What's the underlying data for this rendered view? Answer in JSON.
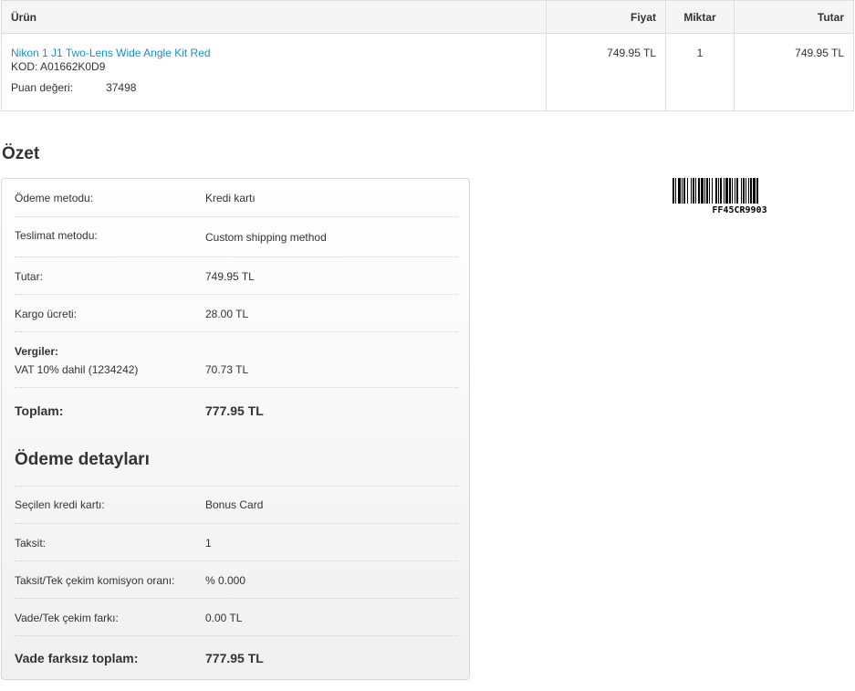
{
  "table": {
    "headers": {
      "product": "Ürün",
      "price": "Fiyat",
      "quantity": "Miktar",
      "total": "Tutar"
    },
    "rows": [
      {
        "name": "Nikon 1 J1 Two-Lens Wide Angle Kit Red",
        "code": "KOD:  A01662K0D9",
        "points_label": "Puan değeri:",
        "points_value": "37498",
        "price": "749.95 TL",
        "quantity": "1",
        "total": "749.95 TL"
      }
    ]
  },
  "summary": {
    "title": "Özet",
    "payment_method_label": "Ödeme metodu:",
    "payment_method_value": "Kredi kartı",
    "shipping_method_label": "Teslimat metodu:",
    "shipping_method_value": "Custom shipping method",
    "subtotal_label": "Tutar:",
    "subtotal_value": "749.95 TL",
    "shipping_cost_label": "Kargo ücreti:",
    "shipping_cost_value": "28.00 TL",
    "taxes_label": "Vergiler:",
    "vat_label": "VAT 10% dahil (1234242)",
    "vat_value": "70.73 TL",
    "total_label": "Toplam:",
    "total_value": "777.95 TL"
  },
  "payment_details": {
    "title": "Ödeme detayları",
    "card_label": "Seçilen kredi kartı:",
    "card_value": "Bonus Card",
    "installment_label": "Taksit:",
    "installment_value": "1",
    "commission_label": "Taksit/Tek çekim komisyon oranı:",
    "commission_value": "% 0.000",
    "difference_label": "Vade/Tek çekim farkı:",
    "difference_value": "0.00 TL",
    "final_label": "Vade farksız toplam:",
    "final_value": "777.95 TL"
  },
  "barcode": {
    "text": "FF45CR9903"
  }
}
